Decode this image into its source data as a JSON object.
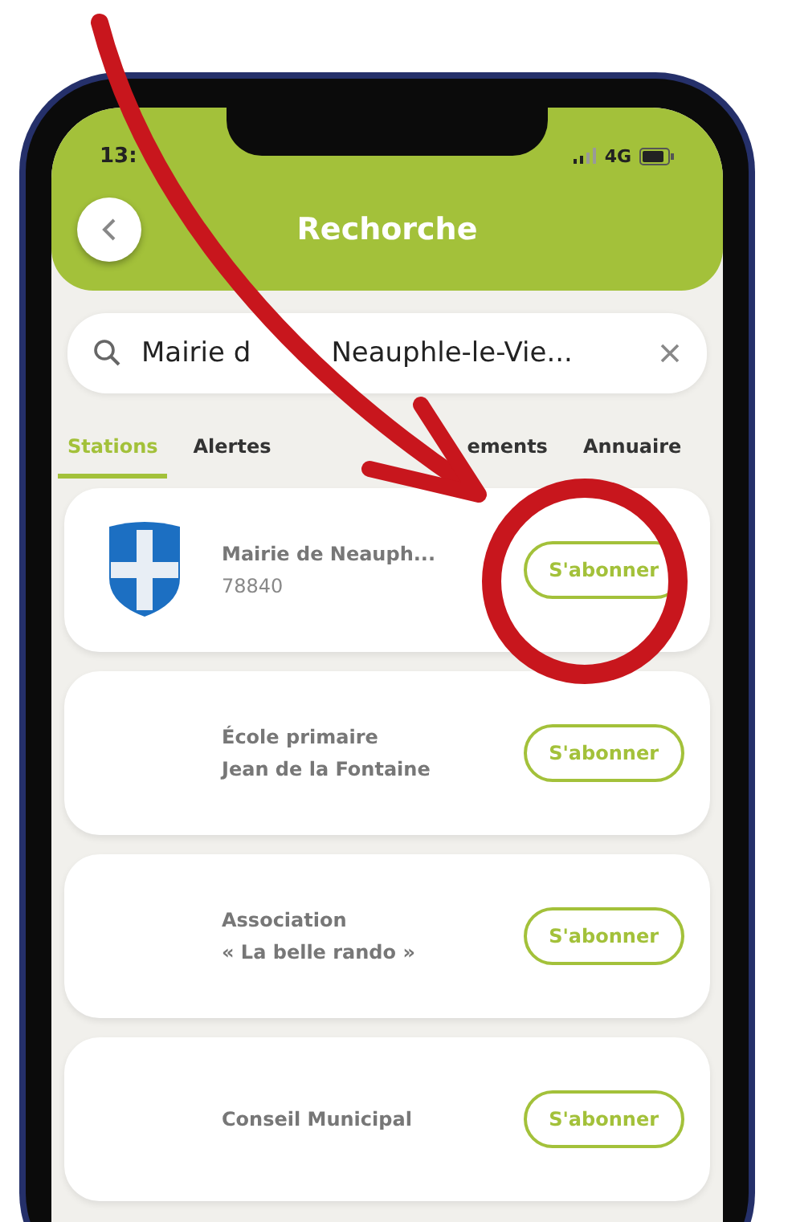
{
  "status_bar": {
    "time": "13:",
    "network": "4G"
  },
  "header": {
    "title": "Rechorche"
  },
  "search": {
    "value_parts": [
      "Mairie d",
      "Neauphle-le-Vie..."
    ]
  },
  "tabs": [
    {
      "label": "Stations",
      "selected": true
    },
    {
      "label": "Alertes",
      "selected": false
    },
    {
      "label": "ements",
      "selected": false
    },
    {
      "label": "Annuaire",
      "selected": false
    }
  ],
  "results": [
    {
      "kind": "crest",
      "title": "Mairie de Neauph...",
      "subtitle": "78840",
      "button": "S'abonner"
    },
    {
      "kind": "plain",
      "title": "École primaire",
      "subtitle": "Jean de la Fontaine",
      "button": "S'abonner"
    },
    {
      "kind": "plain",
      "title": "Association",
      "subtitle": "« La belle rando »",
      "button": "S'abonner"
    },
    {
      "kind": "plain",
      "title": "Conseil Municipal",
      "button": "S'abonner"
    }
  ]
}
